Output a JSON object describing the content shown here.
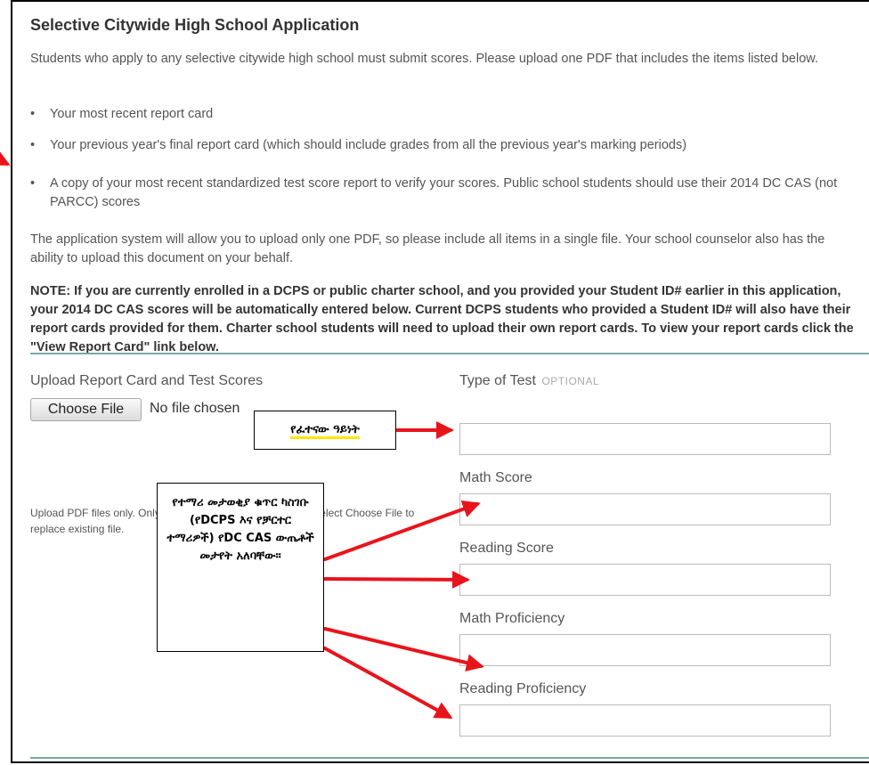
{
  "heading": "Selective Citywide High School Application",
  "intro": "Students who apply to any selective citywide high school must submit scores. Please upload one PDF that includes the items listed below.",
  "items": [
    "Your most recent report card",
    "Your previous year's final report card (which should include grades from all the previous year's marking periods)",
    "A copy of your most recent standardized test score report to verify your scores. Public school students should use their 2014 DC CAS (not PARCC) scores"
  ],
  "bullet": "•",
  "upload_note": "The application system will allow you to upload only one PDF, so please include all items in a single file. Your school counselor also has the ability to upload this document on your behalf.",
  "note": "NOTE: If you are currently enrolled in a DCPS or public charter school, and you provided your Student ID# earlier in this application, your 2014 DC CAS scores will be automatically entered below. Current DCPS students who provided a Student ID# will also have their report cards provided for them. Charter school students will need to upload their own report cards. To view your report cards click the \"View Report Card\" link below.",
  "upload": {
    "label": "Upload Report Card and Test Scores",
    "button": "Choose File",
    "status": "No file chosen",
    "help": "Upload PDF files only. Only one PDF file may be uploaded. Select Choose File to replace existing file."
  },
  "fields": {
    "type_of_test": {
      "label": "Type of Test",
      "tag": "OPTIONAL",
      "value": ""
    },
    "math_score": {
      "label": "Math Score",
      "value": ""
    },
    "reading_score": {
      "label": "Reading Score",
      "value": ""
    },
    "math_proficiency": {
      "label": "Math Proficiency",
      "value": ""
    },
    "reading_proficiency": {
      "label": "Reading Proficiency",
      "value": ""
    }
  },
  "annotations": {
    "callout_test_type": "የፈተናው ዓይነት",
    "callout_scores": "የተማሪ መታወቂያ ቁጥር ካስገቡ (የDCPS እና የቻርተር ተማሪዎች) የDC CAS ውጤቶች መታየት አለባቸው።",
    "arrow_color": "#e8141c",
    "highlight_color": "#ffe600"
  },
  "colors": {
    "divider": "#7aa7a7",
    "text": "#555555",
    "heading": "#333333"
  }
}
